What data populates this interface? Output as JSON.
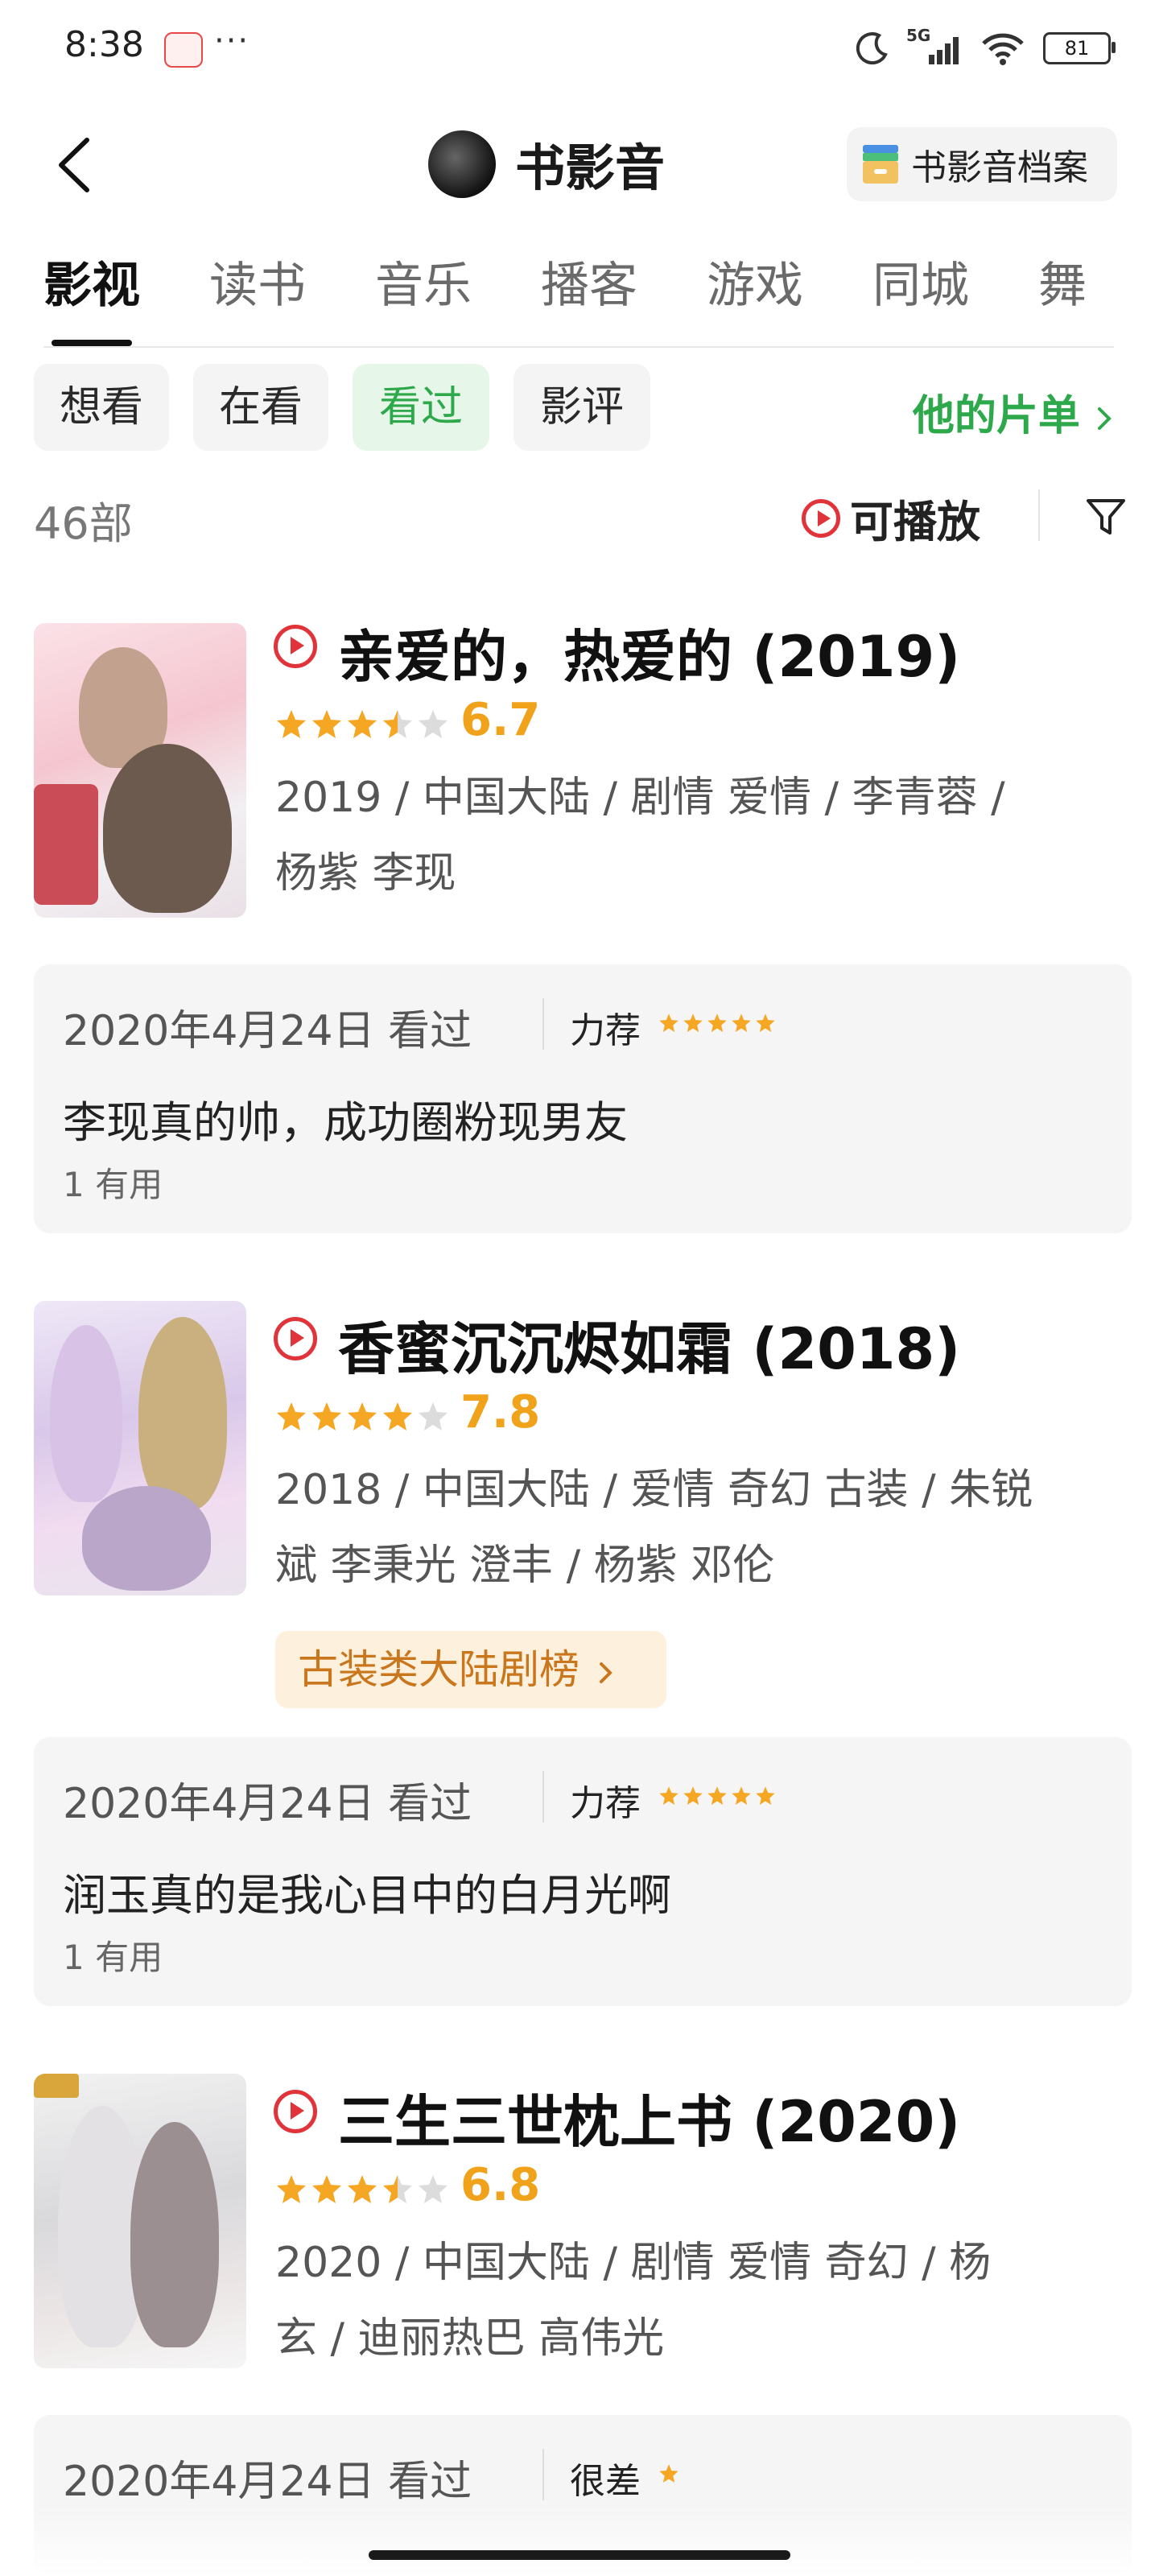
{
  "status_bar": {
    "time": "8:38",
    "dots": "···",
    "battery": "81",
    "network": "5G"
  },
  "header": {
    "title": "书影音",
    "archive_label": "书影音档案"
  },
  "tabs": [
    {
      "label": "影视",
      "active": true
    },
    {
      "label": "读书",
      "active": false
    },
    {
      "label": "音乐",
      "active": false
    },
    {
      "label": "播客",
      "active": false
    },
    {
      "label": "游戏",
      "active": false
    },
    {
      "label": "同城",
      "active": false
    },
    {
      "label": "舞",
      "active": false
    }
  ],
  "filters": [
    {
      "label": "想看",
      "active": false
    },
    {
      "label": "在看",
      "active": false
    },
    {
      "label": "看过",
      "active": true
    },
    {
      "label": "影评",
      "active": false
    }
  ],
  "his_list_label": "他的片单",
  "count": "46部",
  "playable_label": "可播放",
  "colors": {
    "accent_green": "#2da84a",
    "play_red": "#e0343a",
    "score_orange": "#f0a21b",
    "rank_text": "#c9761c"
  },
  "movies": [
    {
      "title": "亲爱的，热爱的 (2019)",
      "stars": 3.5,
      "score": "6.7",
      "meta_line1": "2019 / 中国大陆 / 剧情 爱情 / 李青蓉 /",
      "meta_line2": "杨紫 李现",
      "rank_label": "",
      "review": {
        "date": "2020年4月24日 看过",
        "rating_label": "力荐",
        "rating_stars": 5,
        "text": "李现真的帅，成功圈粉现男友",
        "useful": "1 有用"
      }
    },
    {
      "title": "香蜜沉沉烬如霜 (2018)",
      "stars": 4,
      "score": "7.8",
      "meta_line1": "2018 / 中国大陆 / 爱情 奇幻 古装 / 朱锐",
      "meta_line2": "斌 李秉光 澄丰 / 杨紫 邓伦",
      "rank_label": "古装类大陆剧榜",
      "review": {
        "date": "2020年4月24日 看过",
        "rating_label": "力荐",
        "rating_stars": 5,
        "text": "润玉真的是我心目中的白月光啊",
        "useful": "1 有用"
      }
    },
    {
      "title": "三生三世枕上书 (2020)",
      "stars": 3.5,
      "score": "6.8",
      "meta_line1": "2020 / 中国大陆 / 剧情 爱情 奇幻 / 杨",
      "meta_line2": "玄 / 迪丽热巴 高伟光",
      "rank_label": "",
      "review": {
        "date": "2020年4月24日 看过",
        "rating_label": "很差",
        "rating_stars": 1,
        "text": "",
        "useful": ""
      }
    }
  ]
}
